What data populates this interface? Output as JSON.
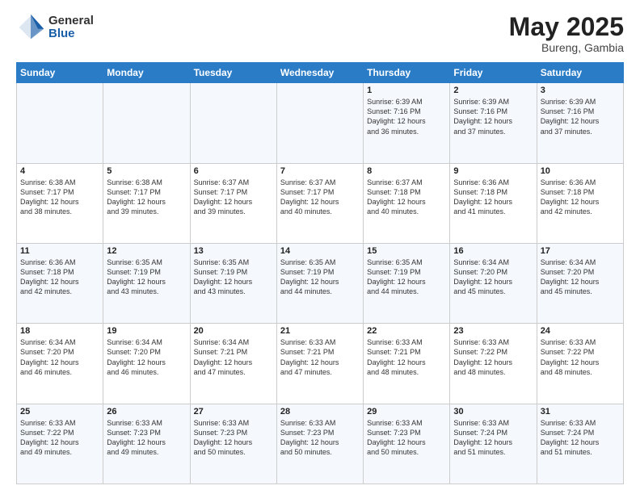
{
  "logo": {
    "general": "General",
    "blue": "Blue"
  },
  "title": {
    "month_year": "May 2025",
    "location": "Bureng, Gambia"
  },
  "days_of_week": [
    "Sunday",
    "Monday",
    "Tuesday",
    "Wednesday",
    "Thursday",
    "Friday",
    "Saturday"
  ],
  "weeks": [
    [
      {
        "day": "",
        "content": ""
      },
      {
        "day": "",
        "content": ""
      },
      {
        "day": "",
        "content": ""
      },
      {
        "day": "",
        "content": ""
      },
      {
        "day": "1",
        "content": "Sunrise: 6:39 AM\nSunset: 7:16 PM\nDaylight: 12 hours\nand 36 minutes."
      },
      {
        "day": "2",
        "content": "Sunrise: 6:39 AM\nSunset: 7:16 PM\nDaylight: 12 hours\nand 37 minutes."
      },
      {
        "day": "3",
        "content": "Sunrise: 6:39 AM\nSunset: 7:16 PM\nDaylight: 12 hours\nand 37 minutes."
      }
    ],
    [
      {
        "day": "4",
        "content": "Sunrise: 6:38 AM\nSunset: 7:17 PM\nDaylight: 12 hours\nand 38 minutes."
      },
      {
        "day": "5",
        "content": "Sunrise: 6:38 AM\nSunset: 7:17 PM\nDaylight: 12 hours\nand 39 minutes."
      },
      {
        "day": "6",
        "content": "Sunrise: 6:37 AM\nSunset: 7:17 PM\nDaylight: 12 hours\nand 39 minutes."
      },
      {
        "day": "7",
        "content": "Sunrise: 6:37 AM\nSunset: 7:17 PM\nDaylight: 12 hours\nand 40 minutes."
      },
      {
        "day": "8",
        "content": "Sunrise: 6:37 AM\nSunset: 7:18 PM\nDaylight: 12 hours\nand 40 minutes."
      },
      {
        "day": "9",
        "content": "Sunrise: 6:36 AM\nSunset: 7:18 PM\nDaylight: 12 hours\nand 41 minutes."
      },
      {
        "day": "10",
        "content": "Sunrise: 6:36 AM\nSunset: 7:18 PM\nDaylight: 12 hours\nand 42 minutes."
      }
    ],
    [
      {
        "day": "11",
        "content": "Sunrise: 6:36 AM\nSunset: 7:18 PM\nDaylight: 12 hours\nand 42 minutes."
      },
      {
        "day": "12",
        "content": "Sunrise: 6:35 AM\nSunset: 7:19 PM\nDaylight: 12 hours\nand 43 minutes."
      },
      {
        "day": "13",
        "content": "Sunrise: 6:35 AM\nSunset: 7:19 PM\nDaylight: 12 hours\nand 43 minutes."
      },
      {
        "day": "14",
        "content": "Sunrise: 6:35 AM\nSunset: 7:19 PM\nDaylight: 12 hours\nand 44 minutes."
      },
      {
        "day": "15",
        "content": "Sunrise: 6:35 AM\nSunset: 7:19 PM\nDaylight: 12 hours\nand 44 minutes."
      },
      {
        "day": "16",
        "content": "Sunrise: 6:34 AM\nSunset: 7:20 PM\nDaylight: 12 hours\nand 45 minutes."
      },
      {
        "day": "17",
        "content": "Sunrise: 6:34 AM\nSunset: 7:20 PM\nDaylight: 12 hours\nand 45 minutes."
      }
    ],
    [
      {
        "day": "18",
        "content": "Sunrise: 6:34 AM\nSunset: 7:20 PM\nDaylight: 12 hours\nand 46 minutes."
      },
      {
        "day": "19",
        "content": "Sunrise: 6:34 AM\nSunset: 7:20 PM\nDaylight: 12 hours\nand 46 minutes."
      },
      {
        "day": "20",
        "content": "Sunrise: 6:34 AM\nSunset: 7:21 PM\nDaylight: 12 hours\nand 47 minutes."
      },
      {
        "day": "21",
        "content": "Sunrise: 6:33 AM\nSunset: 7:21 PM\nDaylight: 12 hours\nand 47 minutes."
      },
      {
        "day": "22",
        "content": "Sunrise: 6:33 AM\nSunset: 7:21 PM\nDaylight: 12 hours\nand 48 minutes."
      },
      {
        "day": "23",
        "content": "Sunrise: 6:33 AM\nSunset: 7:22 PM\nDaylight: 12 hours\nand 48 minutes."
      },
      {
        "day": "24",
        "content": "Sunrise: 6:33 AM\nSunset: 7:22 PM\nDaylight: 12 hours\nand 48 minutes."
      }
    ],
    [
      {
        "day": "25",
        "content": "Sunrise: 6:33 AM\nSunset: 7:22 PM\nDaylight: 12 hours\nand 49 minutes."
      },
      {
        "day": "26",
        "content": "Sunrise: 6:33 AM\nSunset: 7:23 PM\nDaylight: 12 hours\nand 49 minutes."
      },
      {
        "day": "27",
        "content": "Sunrise: 6:33 AM\nSunset: 7:23 PM\nDaylight: 12 hours\nand 50 minutes."
      },
      {
        "day": "28",
        "content": "Sunrise: 6:33 AM\nSunset: 7:23 PM\nDaylight: 12 hours\nand 50 minutes."
      },
      {
        "day": "29",
        "content": "Sunrise: 6:33 AM\nSunset: 7:23 PM\nDaylight: 12 hours\nand 50 minutes."
      },
      {
        "day": "30",
        "content": "Sunrise: 6:33 AM\nSunset: 7:24 PM\nDaylight: 12 hours\nand 51 minutes."
      },
      {
        "day": "31",
        "content": "Sunrise: 6:33 AM\nSunset: 7:24 PM\nDaylight: 12 hours\nand 51 minutes."
      }
    ]
  ]
}
